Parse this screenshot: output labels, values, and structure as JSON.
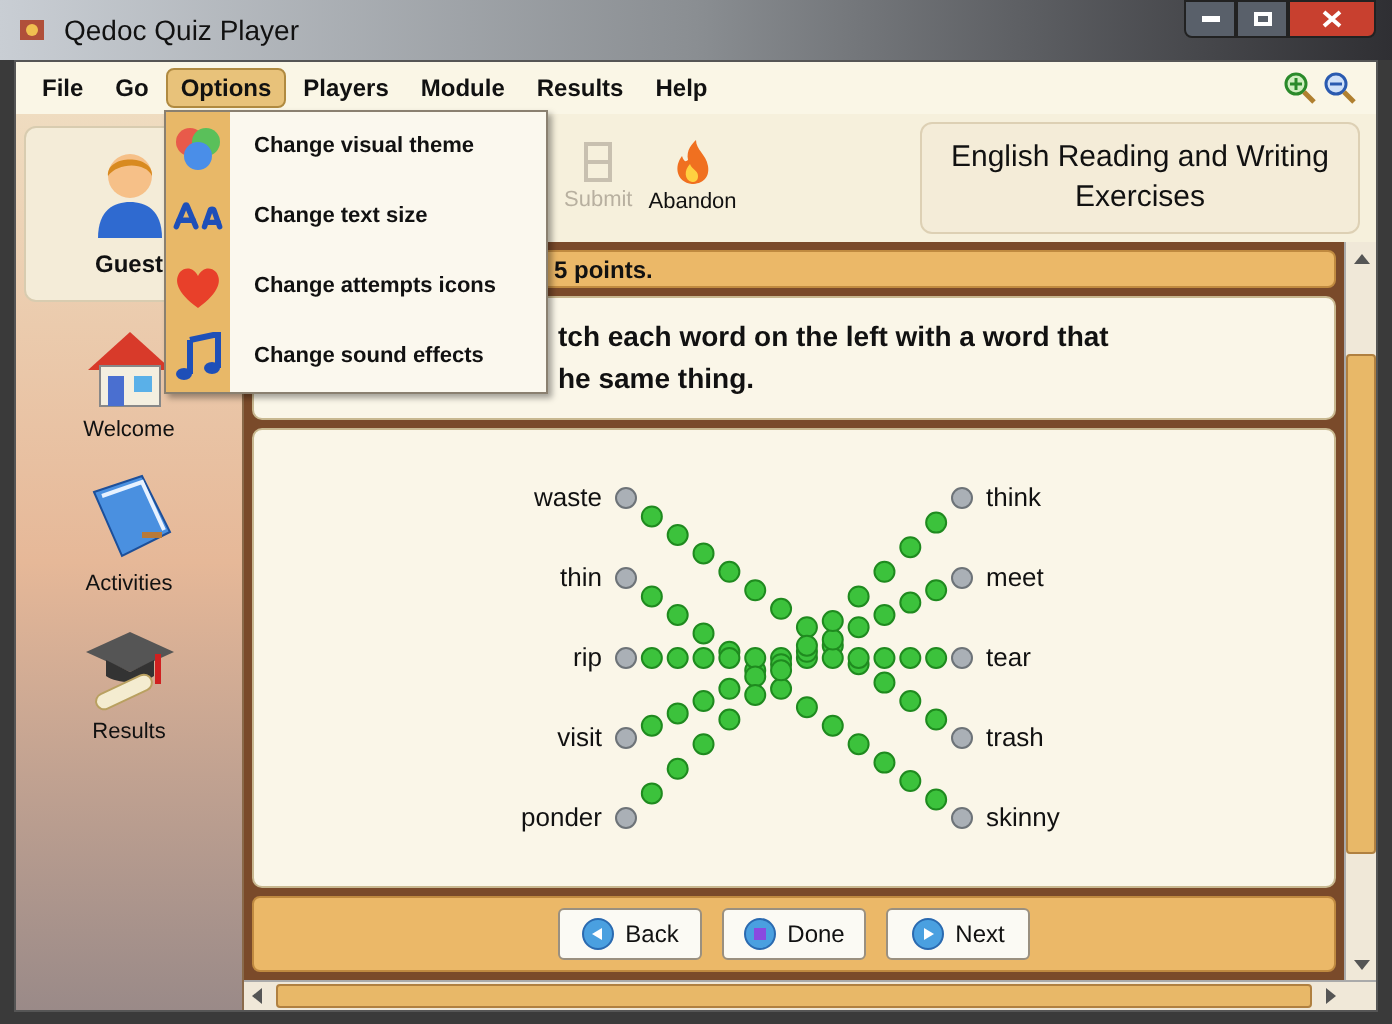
{
  "window": {
    "title": "Qedoc Quiz Player"
  },
  "menu_bar": [
    {
      "label": "File",
      "selected": false
    },
    {
      "label": "Go",
      "selected": false
    },
    {
      "label": "Options",
      "selected": true
    },
    {
      "label": "Players",
      "selected": false
    },
    {
      "label": "Module",
      "selected": false
    },
    {
      "label": "Results",
      "selected": false
    },
    {
      "label": "Help",
      "selected": false
    }
  ],
  "options_menu": [
    {
      "label": "Change visual theme",
      "kind": "theme"
    },
    {
      "label": "Change text size",
      "kind": "text"
    },
    {
      "label": "Change attempts icons",
      "kind": "heart"
    },
    {
      "label": "Change sound effects",
      "kind": "sound"
    }
  ],
  "player": {
    "name": "Guest"
  },
  "sidebar": [
    {
      "label": "Welcome",
      "kind": "home"
    },
    {
      "label": "Activities",
      "kind": "book"
    },
    {
      "label": "Results",
      "kind": "cap"
    }
  ],
  "toolbar": [
    {
      "label": "Submit",
      "kind": "submit",
      "disabled": true
    },
    {
      "label": "Abandon",
      "kind": "fire",
      "disabled": false
    }
  ],
  "module_title": "English Reading and Writing Exercises",
  "question_bar": {
    "points": "5 points."
  },
  "instruction_lines": [
    "tch each word on the left with a word that",
    "he same thing."
  ],
  "left_words": [
    "waste",
    "thin",
    "rip",
    "visit",
    "ponder"
  ],
  "right_words": [
    "think",
    "meet",
    "tear",
    "trash",
    "skinny"
  ],
  "buttons": [
    {
      "label": "Back",
      "kind": "back"
    },
    {
      "label": "Done",
      "kind": "done"
    },
    {
      "label": "Next",
      "kind": "next"
    }
  ]
}
